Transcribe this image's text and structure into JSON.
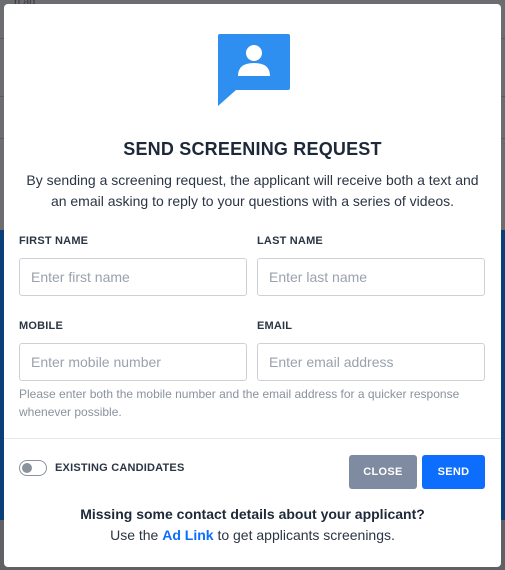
{
  "background": {
    "partial_text": "b ad"
  },
  "modal": {
    "icon": "chat-bubble-user-icon",
    "title": "SEND SCREENING REQUEST",
    "description": "By sending a screening request, the applicant will receive both a text and an email asking to reply to your questions with a series of videos.",
    "fields": {
      "first_name": {
        "label": "FIRST NAME",
        "placeholder": "Enter first name",
        "value": ""
      },
      "last_name": {
        "label": "LAST NAME",
        "placeholder": "Enter last name",
        "value": ""
      },
      "mobile": {
        "label": "MOBILE",
        "placeholder": "Enter mobile number",
        "value": ""
      },
      "email": {
        "label": "EMAIL",
        "placeholder": "Enter email address",
        "value": ""
      }
    },
    "hint": "Please enter both the mobile number and the email address for a quicker response whenever possible.",
    "toggle": {
      "label": "EXISTING CANDIDATES",
      "on": false
    },
    "buttons": {
      "close": "CLOSE",
      "send": "SEND"
    },
    "footer": {
      "question": "Missing some contact details about your applicant?",
      "prefix": "Use the ",
      "link": "Ad Link",
      "suffix": " to get applicants screenings."
    }
  },
  "colors": {
    "accent": "#0d6efd",
    "icon": "#2f8ff0",
    "close_button": "#7f8ba0",
    "title": "#1d2838"
  }
}
